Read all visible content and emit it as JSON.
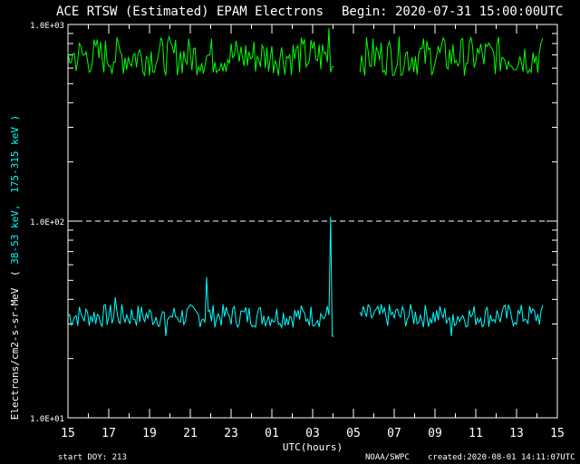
{
  "header": {
    "title": "ACE RTSW (Estimated) EPAM Electrons",
    "begin": "Begin: 2020-07-31 15:00:00UTC"
  },
  "footer": {
    "start_doy": "start DOY:  213",
    "source": "NOAA/SWPC",
    "created": "created:2020-08-01 14:11:07UTC"
  },
  "colors": {
    "background": "#000000",
    "axes": "#ffffff",
    "series_low": "#00ffff",
    "series_high": "#00ff00"
  },
  "chart_data": {
    "type": "line",
    "title": "ACE RTSW (Estimated) EPAM Electrons",
    "xlabel": "UTC(hours)",
    "ylabel_parts": [
      "Electrons/cm2-s-sr-MeV",
      "( ",
      "38-53 keV,",
      "175-315 keV",
      ")"
    ],
    "yscale": "log",
    "ylim": [
      10,
      1000
    ],
    "y_tick_labels": [
      "1.0E+01",
      "1.0E+02",
      "1.0E+03"
    ],
    "y_tick_values": [
      10,
      100,
      1000
    ],
    "x_tick_labels": [
      "15",
      "17",
      "19",
      "21",
      "23",
      "01",
      "03",
      "05",
      "07",
      "09",
      "11",
      "13",
      "15"
    ],
    "xlim_hours": [
      0,
      24
    ],
    "reference_line": 100,
    "gap_hours": [
      13.1,
      14.3
    ],
    "series": [
      {
        "label": "38-53 keV",
        "color": "#00ffff",
        "baseline": 33,
        "spread": 0.06,
        "spikes": [
          {
            "hour": 2.3,
            "value": 41
          },
          {
            "hour": 6.8,
            "value": 52
          },
          {
            "hour": 12.9,
            "value": 105
          },
          {
            "hour": 13.0,
            "value": 26
          },
          {
            "hour": 4.8,
            "value": 26
          },
          {
            "hour": 18.8,
            "value": 26
          }
        ]
      },
      {
        "label": "175-315 keV",
        "color": "#00ff00",
        "baseline": 690,
        "spread": 0.1,
        "spikes": [
          {
            "hour": 12.8,
            "value": 960
          },
          {
            "hour": 13.0,
            "value": 610
          }
        ]
      }
    ]
  }
}
